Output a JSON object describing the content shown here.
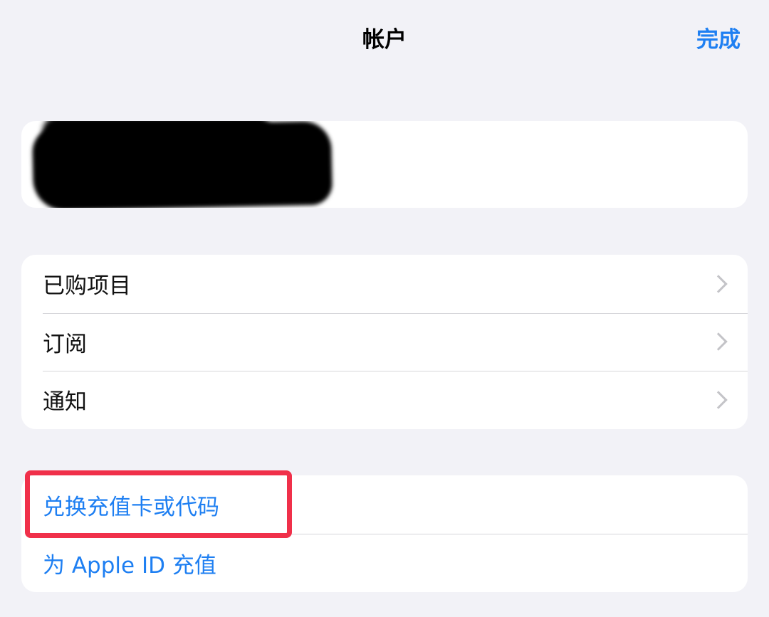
{
  "nav": {
    "title": "帐户",
    "done_label": "完成"
  },
  "menu": {
    "items": [
      {
        "label": "已购项目"
      },
      {
        "label": "订阅"
      },
      {
        "label": "通知"
      }
    ]
  },
  "actions": {
    "items": [
      {
        "label": "兑换充值卡或代码"
      },
      {
        "label": "为 Apple ID 充值"
      }
    ]
  },
  "colors": {
    "accent": "#1e7ff2",
    "highlight": "#f0304a",
    "background": "#f2f2f7"
  }
}
